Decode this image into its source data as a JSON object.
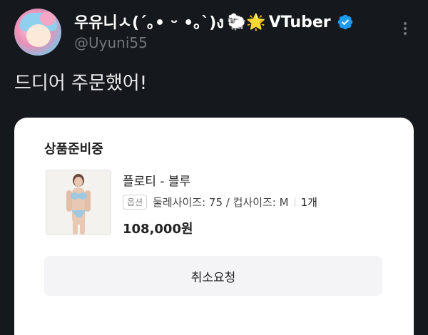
{
  "tweet": {
    "display_name": "우유니ㅅ(´｡• ᵕ •｡`)ง",
    "name_emoji": "🐑🌟",
    "name_suffix": "VTuber",
    "handle": "@Uyuni55",
    "text": "드디어 주문했어!",
    "verified_color": "#1d9bf0"
  },
  "order_card": {
    "status": "상품준비중",
    "product_name": "플로티 - 블루",
    "option_badge": "옵션",
    "option_text": "둘레사이즈: 75 / 컵사이즈: M",
    "quantity": "1개",
    "price": "108,000원",
    "cancel_label": "취소요청"
  },
  "icons": {
    "verified": "verified-badge-icon",
    "more": "more-options-icon"
  }
}
